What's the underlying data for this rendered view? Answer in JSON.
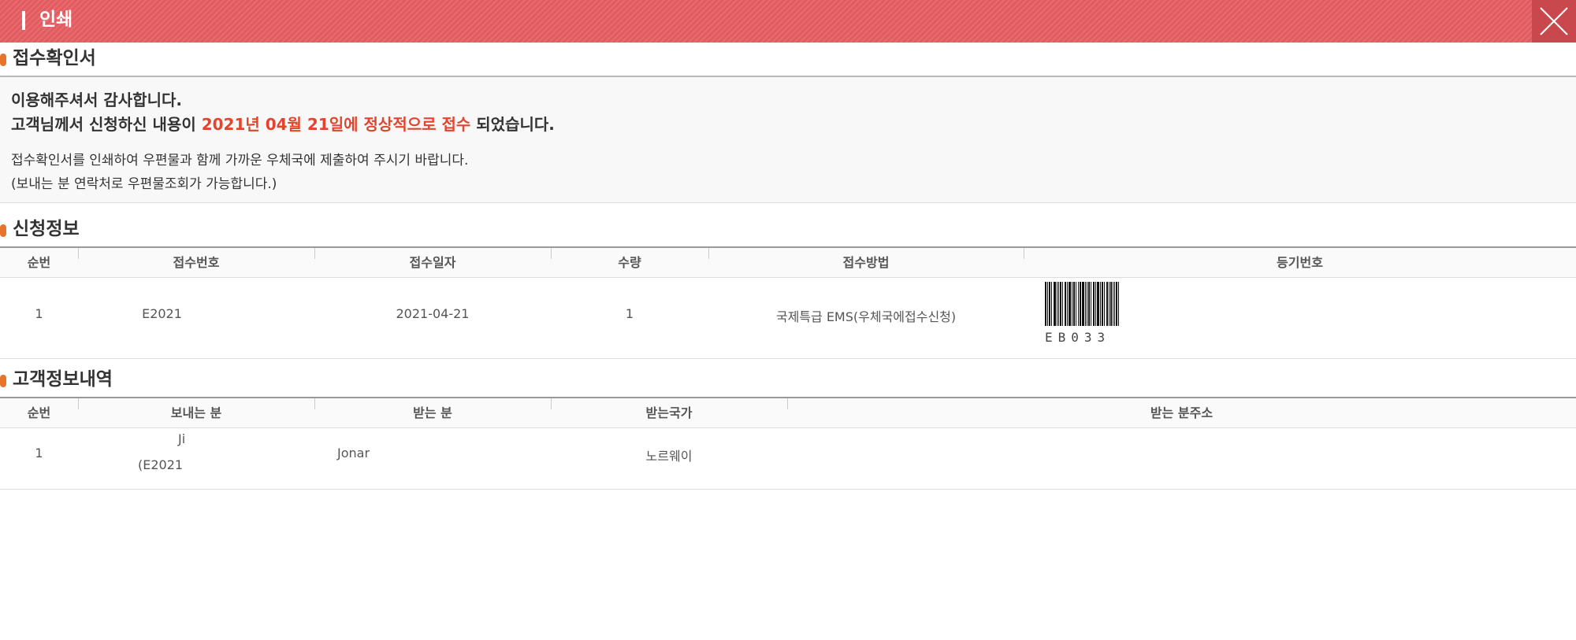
{
  "window": {
    "title": "인쇄",
    "close_label": "닫기"
  },
  "receipt": {
    "heading": "접수확인서",
    "line1": "이용해주셔서 감사합니다.",
    "line2_prefix": "고객님께서 신청하신 내용이 ",
    "line2_highlight": "2021년 04월 21일에 정상적으로 접수",
    "line2_suffix": " 되었습니다.",
    "line3": "접수확인서를 인쇄하여 우편물과 함께 가까운 우체국에 제출하여 주시기 바랍니다.",
    "line4": "(보내는 분 연락처로 우편물조회가 가능합니다.)",
    "highlight_color": "#e4442c"
  },
  "application": {
    "heading": "신청정보",
    "columns": [
      "순번",
      "접수번호",
      "접수일자",
      "수량",
      "접수방법",
      "등기번호"
    ],
    "rows": [
      {
        "seq": "1",
        "receipt_no": "E2021",
        "date": "2021-04-21",
        "qty": "1",
        "method": "국제특급 EMS(우체국에접수신청)",
        "registered_no": "EB033"
      }
    ]
  },
  "customer": {
    "heading": "고객정보내역",
    "columns": [
      "순번",
      "보내는 분",
      "받는 분",
      "받는국가",
      "받는 분주소"
    ],
    "rows": [
      {
        "seq": "1",
        "sender_line1": "Ji",
        "sender_line2": "(E2021",
        "receiver": "Jonar",
        "country": "노르웨이",
        "address": ""
      }
    ]
  },
  "colors": {
    "titlebar": "#e35b60",
    "accent_dot": "#e8742a"
  },
  "icons": {
    "close": "close-icon"
  }
}
